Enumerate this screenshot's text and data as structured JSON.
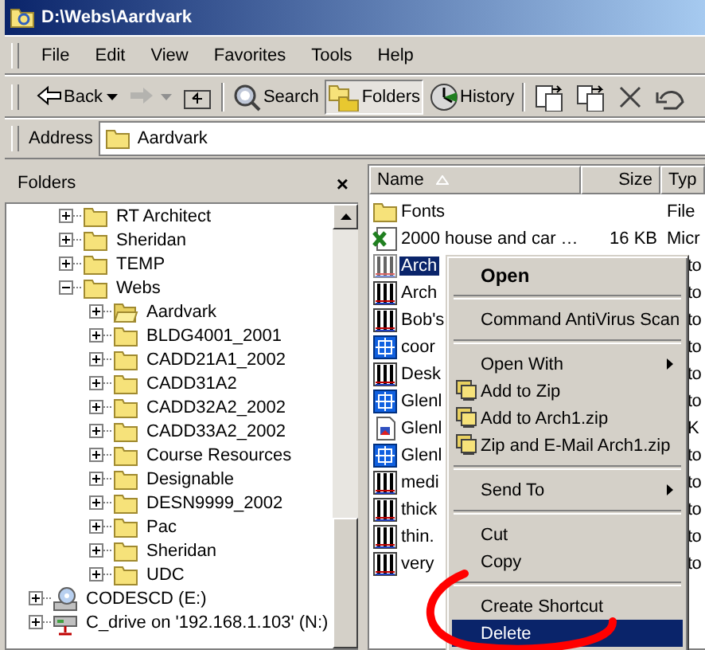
{
  "window": {
    "title": "D:\\Webs\\Aardvark"
  },
  "menu_bar": [
    "File",
    "Edit",
    "View",
    "Favorites",
    "Tools",
    "Help"
  ],
  "toolbar": [
    {
      "kind": "back",
      "label": "Back",
      "disabled": false,
      "pressed": false
    },
    {
      "kind": "forward",
      "disabled": true,
      "pressed": false
    },
    {
      "kind": "up",
      "disabled": false,
      "pressed": false
    },
    {
      "kind": "search",
      "label": "Search",
      "disabled": false,
      "pressed": false
    },
    {
      "kind": "folders",
      "label": "Folders",
      "disabled": false,
      "pressed": true
    },
    {
      "kind": "history",
      "label": "History",
      "disabled": false,
      "pressed": false
    },
    {
      "kind": "move",
      "disabled": false,
      "pressed": false
    },
    {
      "kind": "copy",
      "disabled": false,
      "pressed": false
    },
    {
      "kind": "delete",
      "disabled": false,
      "pressed": false
    },
    {
      "kind": "undo",
      "disabled": false,
      "pressed": false
    }
  ],
  "address": {
    "label": "Address",
    "value": "Aardvark"
  },
  "folders_pane": {
    "title": "Folders",
    "close": "×"
  },
  "tree": [
    {
      "kind": "hidden",
      "children": [
        {
          "label": "RT Architect",
          "kind": "folder",
          "expanded": false
        },
        {
          "label": "Sheridan",
          "kind": "folder",
          "expanded": false
        },
        {
          "label": "TEMP",
          "kind": "folder",
          "expanded": false
        },
        {
          "label": "Webs",
          "kind": "folder",
          "expanded": true,
          "children": [
            {
              "label": "Aardvark",
              "kind": "open-folder",
              "expanded": false
            },
            {
              "label": "BLDG4001_2001",
              "kind": "folder",
              "expanded": false
            },
            {
              "label": "CADD21A1_2002",
              "kind": "folder",
              "expanded": false
            },
            {
              "label": "CADD31A2",
              "kind": "folder",
              "expanded": false
            },
            {
              "label": "CADD32A2_2002",
              "kind": "folder",
              "expanded": false
            },
            {
              "label": "CADD33A2_2002",
              "kind": "folder",
              "expanded": false
            },
            {
              "label": "Course Resources",
              "kind": "folder",
              "expanded": false
            },
            {
              "label": "Designable",
              "kind": "folder",
              "expanded": false
            },
            {
              "label": "DESN9999_2002",
              "kind": "folder",
              "expanded": false
            },
            {
              "label": "Pac",
              "kind": "folder",
              "expanded": false
            },
            {
              "label": "Sheridan",
              "kind": "folder",
              "expanded": false
            },
            {
              "label": "UDC",
              "kind": "folder",
              "expanded": false
            }
          ]
        }
      ]
    },
    {
      "label": "CODESCD (E:)",
      "kind": "cd-drive",
      "expanded": false
    },
    {
      "label": "C_drive on '192.168.1.103' (N:)",
      "kind": "network-drive",
      "expanded": false
    }
  ],
  "file_list": {
    "columns": [
      "Name",
      "Size",
      "Typ"
    ],
    "rows": [
      {
        "kind": "folder",
        "name": "Fonts",
        "size": "",
        "type": "File",
        "selected": false
      },
      {
        "kind": "spreadsheet",
        "name": "2000 house and car …",
        "size": "16 KB",
        "type": "Micr",
        "selected": false
      },
      {
        "kind": "drawing",
        "name": "Arch",
        "type_tail": "to",
        "selected": true
      },
      {
        "kind": "drawing",
        "name": "Arch",
        "type_tail": "to",
        "selected": false
      },
      {
        "kind": "drawing",
        "name": "Bob's",
        "type_tail": "to",
        "selected": false
      },
      {
        "kind": "plan",
        "name": "coor",
        "type_tail": "to",
        "selected": false
      },
      {
        "kind": "drawing",
        "name": "Desk",
        "type_tail": "to",
        "selected": false
      },
      {
        "kind": "plan",
        "name": "Glenl",
        "type_tail": "to",
        "selected": false
      },
      {
        "kind": "image",
        "name": "Glenl",
        "type_tail": "K",
        "selected": false
      },
      {
        "kind": "plan",
        "name": "Glenl",
        "type_tail": "to",
        "selected": false
      },
      {
        "kind": "drawing",
        "name": "medi",
        "type_tail": "to",
        "selected": false
      },
      {
        "kind": "drawing",
        "name": "thick",
        "type_tail": "to",
        "selected": false
      },
      {
        "kind": "drawing",
        "name": "thin.",
        "type_tail": "to",
        "selected": false
      },
      {
        "kind": "drawing",
        "name": "very",
        "type_tail": "to",
        "selected": false
      }
    ]
  },
  "context_menu": [
    {
      "kind": "item",
      "label": "Open",
      "default": true,
      "submenu": false,
      "zip": false,
      "selected": false
    },
    {
      "kind": "separator"
    },
    {
      "kind": "item",
      "label": "Command AntiVirus Scan",
      "default": false,
      "submenu": false,
      "zip": false,
      "selected": false
    },
    {
      "kind": "separator"
    },
    {
      "kind": "item",
      "label": "Open With",
      "default": false,
      "submenu": true,
      "zip": false,
      "selected": false
    },
    {
      "kind": "item",
      "label": "Add to Zip",
      "default": false,
      "submenu": false,
      "zip": true,
      "selected": false
    },
    {
      "kind": "item",
      "label": "Add to Arch1.zip",
      "default": false,
      "submenu": false,
      "zip": true,
      "selected": false
    },
    {
      "kind": "item",
      "label": "Zip and E-Mail Arch1.zip",
      "default": false,
      "submenu": false,
      "zip": true,
      "selected": false
    },
    {
      "kind": "separator"
    },
    {
      "kind": "item",
      "label": "Send To",
      "default": false,
      "submenu": true,
      "zip": false,
      "selected": false
    },
    {
      "kind": "separator"
    },
    {
      "kind": "item",
      "label": "Cut",
      "default": false,
      "submenu": false,
      "zip": false,
      "selected": false
    },
    {
      "kind": "item",
      "label": "Copy",
      "default": false,
      "submenu": false,
      "zip": false,
      "selected": false
    },
    {
      "kind": "separator"
    },
    {
      "kind": "item",
      "label": "Create Shortcut",
      "default": false,
      "submenu": false,
      "zip": false,
      "selected": false
    },
    {
      "kind": "item",
      "label": "Delete",
      "default": false,
      "submenu": false,
      "zip": false,
      "selected": true
    }
  ],
  "annotation": {
    "kind": "ellipse"
  }
}
